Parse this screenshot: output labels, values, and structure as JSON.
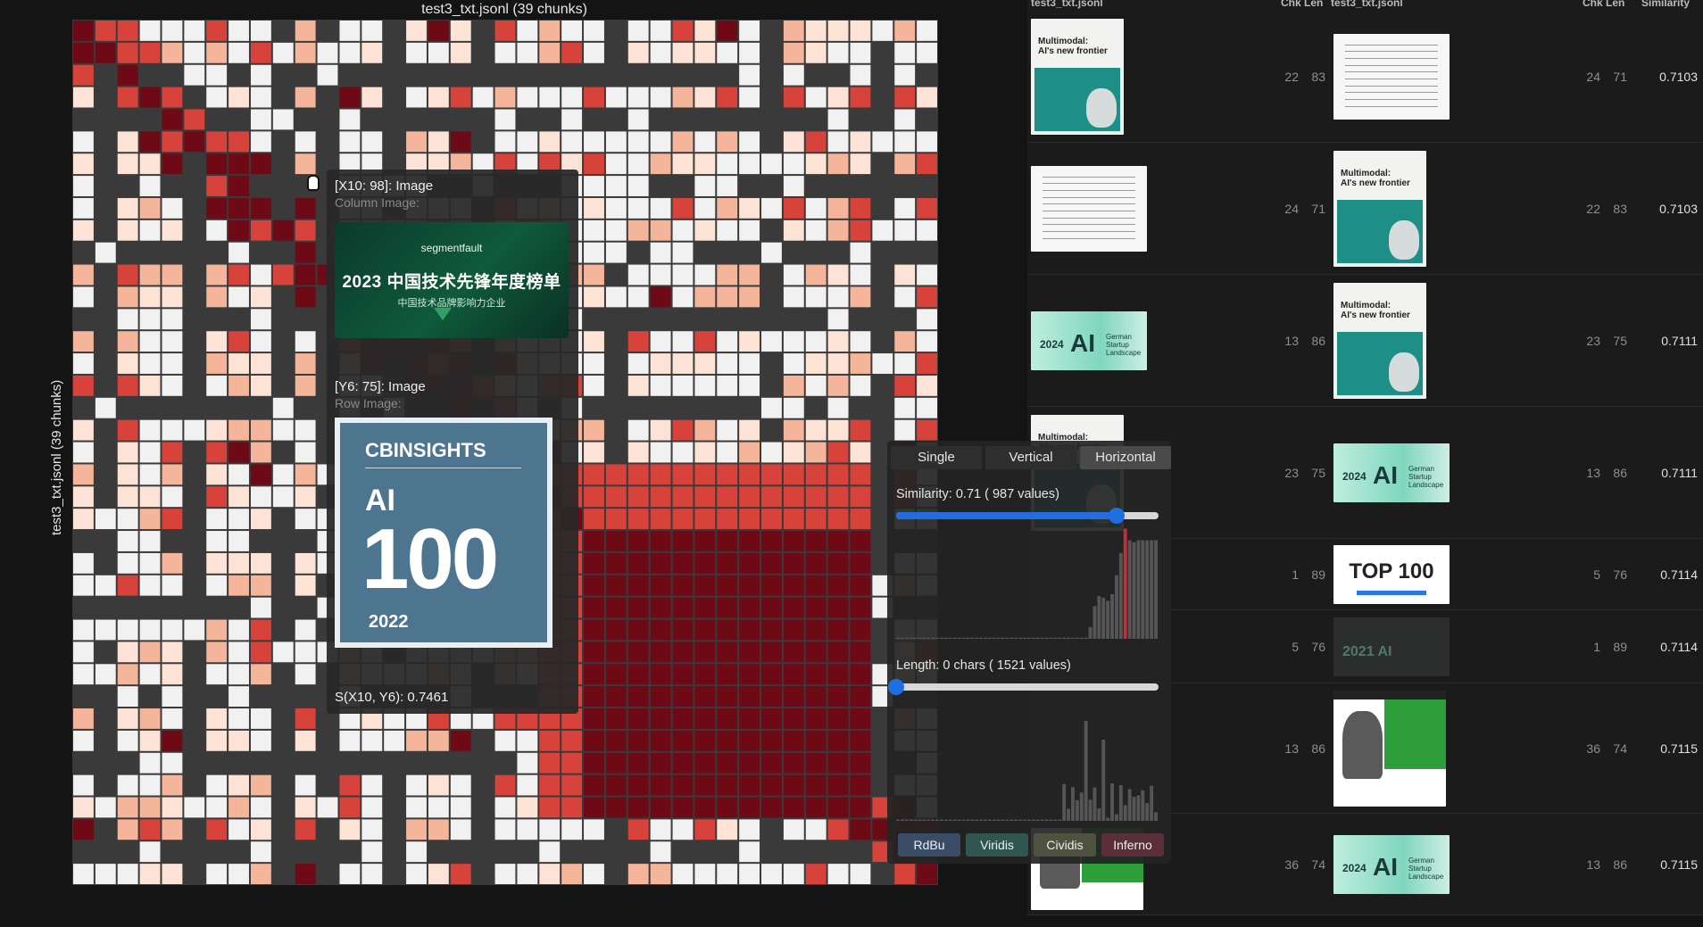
{
  "heatmap": {
    "title": "test3_txt.jsonl (39 chunks)",
    "ylabel": "test3_txt.jsonl (39 chunks)",
    "colors": {
      "dark_red": "#6d0a16",
      "mid_red": "#d7423a",
      "light": "#f4b59a",
      "pale": "#fde3d6",
      "white": "#f1f1f1",
      "gray": "#3a3a3a"
    }
  },
  "tooltip": {
    "col_head": "[X10: 98]: Image",
    "col_sub": "Column Image:",
    "col_img": {
      "brand": "segmentfault",
      "big": "2023 中国技术先锋年度榜单",
      "small": "中国技术品牌影响力企业"
    },
    "row_head": "[Y6: 75]: Image",
    "row_sub": "Row Image:",
    "row_img": {
      "brand": "CBINSIGHTS",
      "ai": "AI",
      "num": "100",
      "year": "2022"
    },
    "score": "S(X10, Y6): 0.7461"
  },
  "panel": {
    "tabs": [
      "Single",
      "Vertical",
      "Horizontal"
    ],
    "active_tab": 2,
    "similarity_label": "Similarity: 0.71 ( 987 values)",
    "similarity_value": 0.84,
    "length_label": "Length: 0 chars ( 1521 values)",
    "length_value": 0.0,
    "colormaps": [
      {
        "label": "RdBu",
        "color": "#3b4d66"
      },
      {
        "label": "Viridis",
        "color": "#2f5650"
      },
      {
        "label": "Cividis",
        "color": "#4f5240"
      },
      {
        "label": "Inferno",
        "color": "#5b2f3a"
      }
    ]
  },
  "table": {
    "headers": [
      "test3_txt.jsonl",
      "Chk",
      "Len",
      "test3_txt.jsonl",
      "Chk",
      "Len",
      "Similarity"
    ],
    "rows": [
      {
        "a_thumb": "mit",
        "a_chk": "22",
        "a_len": "83",
        "b_thumb": "doc",
        "b_chk": "24",
        "b_len": "71",
        "sim": "0.7103"
      },
      {
        "a_thumb": "doc",
        "a_chk": "24",
        "a_len": "71",
        "b_thumb": "mit",
        "b_chk": "22",
        "b_len": "83",
        "sim": "0.7103"
      },
      {
        "a_thumb": "ger",
        "a_chk": "13",
        "a_len": "86",
        "b_thumb": "mit",
        "b_chk": "23",
        "b_len": "75",
        "sim": "0.7111"
      },
      {
        "a_thumb": "mit",
        "a_chk": "23",
        "a_len": "75",
        "b_thumb": "ger",
        "b_chk": "13",
        "b_len": "86",
        "sim": "0.7111"
      },
      {
        "a_thumb": "none",
        "a_chk": "1",
        "a_len": "89",
        "b_thumb": "top",
        "b_chk": "5",
        "b_len": "76",
        "sim": "0.7114"
      },
      {
        "a_thumb": "none",
        "a_chk": "5",
        "a_len": "76",
        "b_thumb": "dark",
        "b_chk": "1",
        "b_len": "89",
        "sim": "0.7114"
      },
      {
        "a_thumb": "none",
        "a_chk": "13",
        "a_len": "86",
        "b_thumb": "web",
        "b_chk": "36",
        "b_len": "74",
        "sim": "0.7115"
      },
      {
        "a_thumb": "web",
        "a_chk": "36",
        "a_len": "74",
        "b_thumb": "ger",
        "b_chk": "13",
        "b_len": "86",
        "sim": "0.7115"
      }
    ],
    "thumb_text": {
      "mit_hdr": "Multimodal:\nAI's new frontier",
      "ger_year": "2024",
      "ger_ai": "AI",
      "ger_words": "German\nStartup\nLandscape",
      "top": "TOP 100",
      "dark_year": "2021 AI"
    }
  }
}
